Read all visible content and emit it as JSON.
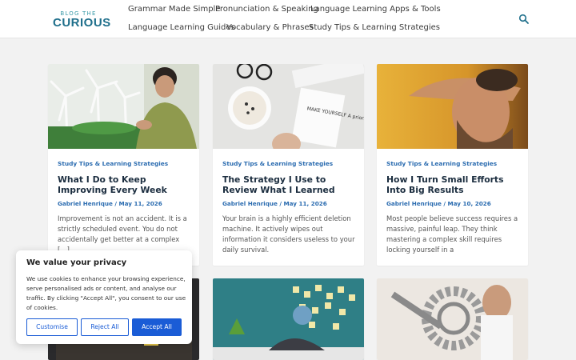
{
  "header": {
    "logo_small": "BLOG THE",
    "logo_big": "CURIOUS",
    "nav": [
      {
        "label": "Grammar Made Simple"
      },
      {
        "label": "Pronunciation & Speaking"
      },
      {
        "label": "Language Learning Apps & Tools"
      },
      {
        "label": "Language Learning Guides"
      },
      {
        "label": "Vocabulary & Phrases"
      },
      {
        "label": "Study Tips & Learning Strategies"
      }
    ],
    "search_icon": "search-icon"
  },
  "posts": [
    {
      "category": "Study Tips & Learning Strategies",
      "title": "What I Do to Keep Improving Every Week",
      "meta": "Gabriel Henrique / May 11, 2026",
      "excerpt": "Improvement is not an accident. It is a strictly scheduled event. You do not accidentally get better at a complex […]"
    },
    {
      "category": "Study Tips & Learning Strategies",
      "title": "The Strategy I Use to Review What I Learned",
      "meta": "Gabriel Henrique / May 11, 2026",
      "excerpt": "Your brain is a highly efficient deletion machine. It actively wipes out information it considers useless to your daily survival."
    },
    {
      "category": "Study Tips & Learning Strategies",
      "title": "How I Turn Small Efforts Into Big Results",
      "meta": "Gabriel Henrique / May 10, 2026",
      "excerpt": "Most people believe success requires a massive, painful leap. They think mastering a complex skill requires locking yourself in a"
    }
  ],
  "notebook_text": "MAKE YOURSELF A priority",
  "cookie": {
    "heading": "We value your privacy",
    "body": "We use cookies to enhance your browsing experience, serve personalised ads or content, and analyse our traffic. By clicking \"Accept All\", you consent to our use of cookies.",
    "customise": "Customise",
    "reject": "Reject All",
    "accept": "Accept All"
  },
  "colors": {
    "accent": "#2b6cb0",
    "button": "#1a5cd6",
    "title": "#1b2d3f",
    "background": "#f2f2f2"
  }
}
